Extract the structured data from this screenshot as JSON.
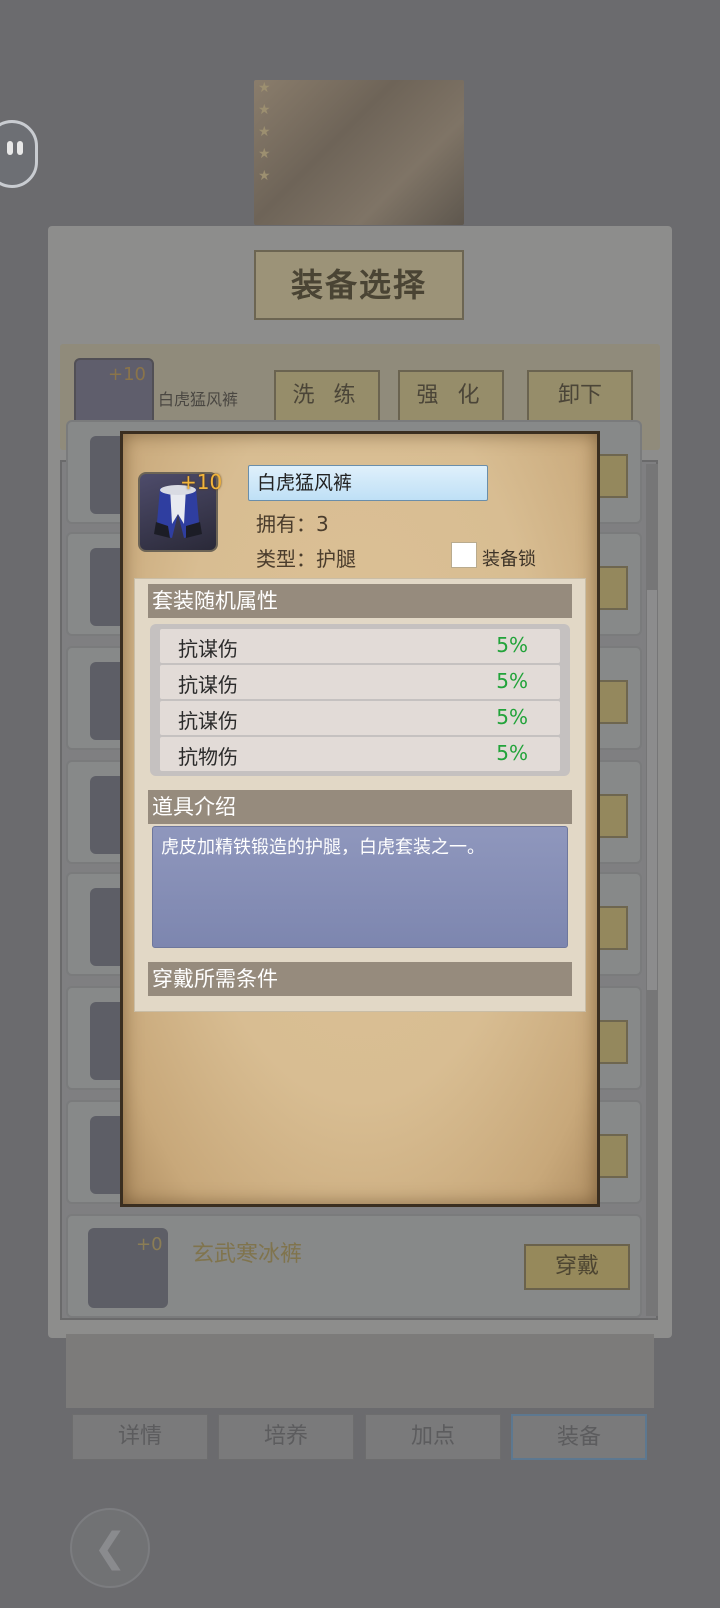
{
  "background": {
    "panel_title": "装备选择",
    "current_item": {
      "level": "+10",
      "name": "白虎猛风裤",
      "buttons": [
        "洗 练",
        "强 化",
        "卸下"
      ]
    },
    "last_row": {
      "level": "+0",
      "name": "玄武寒冰裤",
      "button": "穿戴"
    },
    "tabs": [
      "详情",
      "培养",
      "加点",
      "装备"
    ],
    "active_tab": "装备",
    "back_icon": "back-arrow-icon"
  },
  "modal": {
    "item_level": "+10",
    "item_name": "白虎猛风裤",
    "owned": "拥有：3",
    "type": "类型：护腿",
    "lock_label": "装备锁",
    "set_attr_header": "套装随机属性",
    "attributes": [
      {
        "name": "抗谋伤",
        "value": "5%"
      },
      {
        "name": "抗谋伤",
        "value": "5%"
      },
      {
        "name": "抗谋伤",
        "value": "5%"
      },
      {
        "name": "抗物伤",
        "value": "5%"
      }
    ],
    "desc_header": "道具介绍",
    "description": "虎皮加精铁锻造的护腿，白虎套装之一。",
    "req_header": "穿戴所需条件"
  },
  "colors": {
    "modal_bg": "#d8bd92",
    "attr_value": "#22a33a",
    "level_text": "#f2b43b",
    "desc_bg": "#8f97bd"
  }
}
